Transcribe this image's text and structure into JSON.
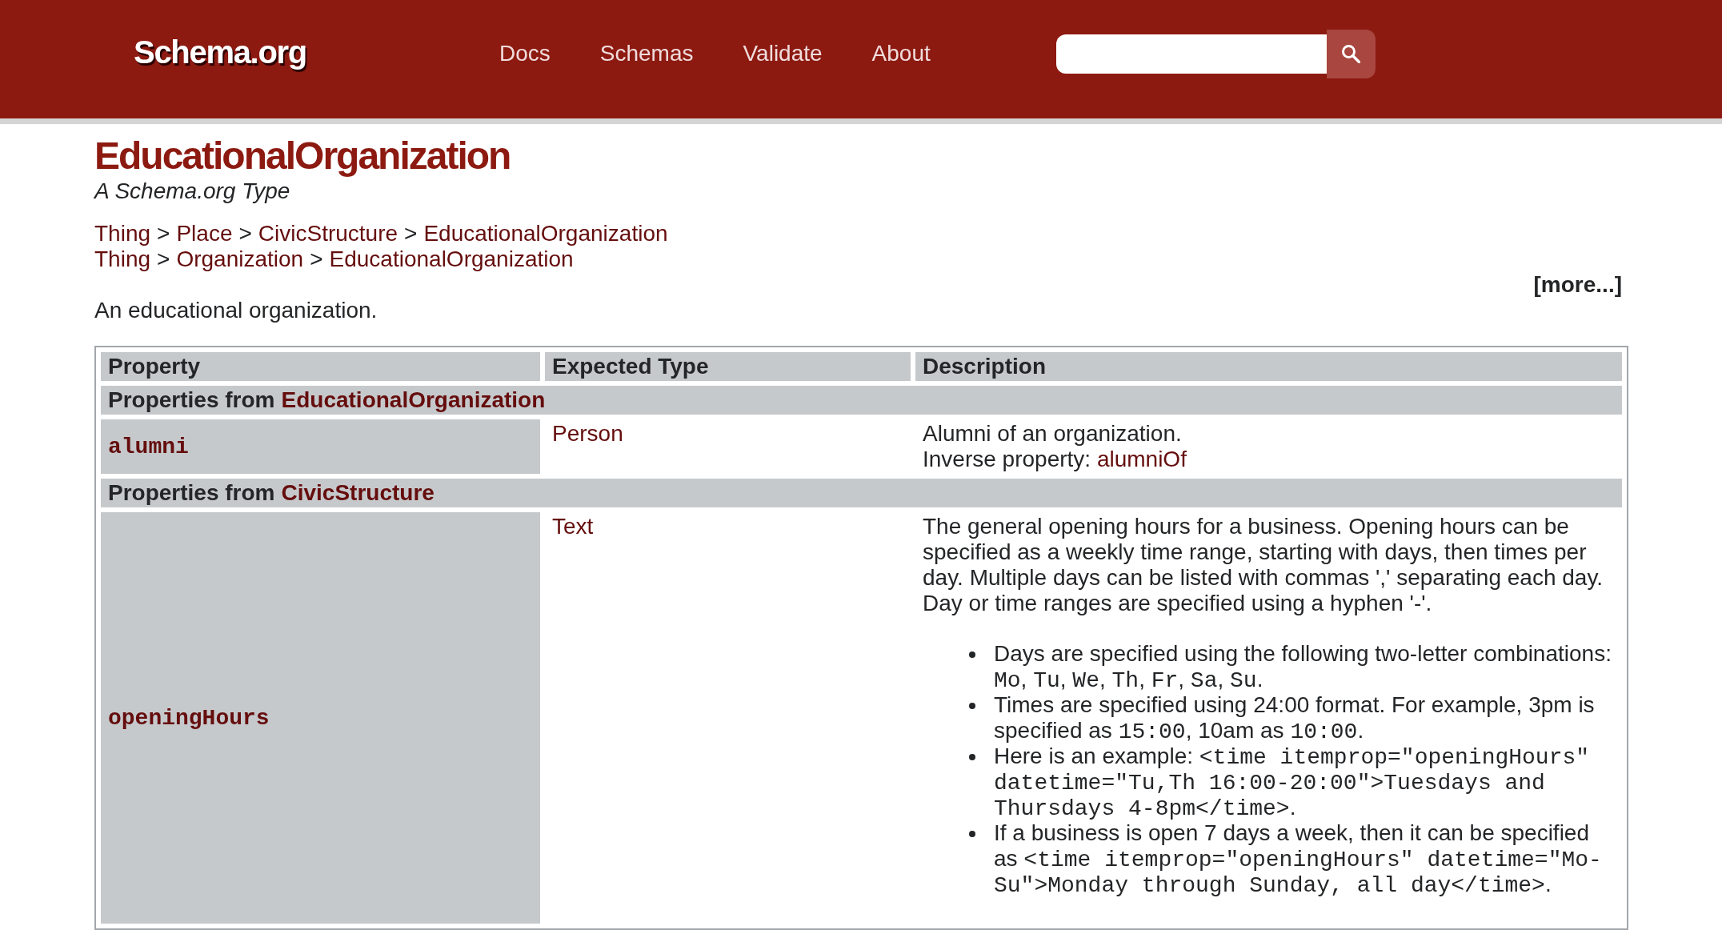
{
  "header": {
    "logo": "Schema.org",
    "nav": [
      "Docs",
      "Schemas",
      "Validate",
      "About"
    ]
  },
  "page": {
    "title": "EducationalOrganization",
    "subtitle": "A Schema.org Type",
    "breadcrumbs": [
      [
        {
          "kind": "link",
          "text": "Thing"
        },
        {
          "kind": "separator",
          "text": ">"
        },
        {
          "kind": "link",
          "text": "Place"
        },
        {
          "kind": "separator",
          "text": ">"
        },
        {
          "kind": "link",
          "text": "CivicStructure"
        },
        {
          "kind": "separator",
          "text": ">"
        },
        {
          "kind": "link",
          "text": "EducationalOrganization"
        }
      ],
      [
        {
          "kind": "link",
          "text": "Thing"
        },
        {
          "kind": "separator",
          "text": ">"
        },
        {
          "kind": "link",
          "text": "Organization"
        },
        {
          "kind": "separator",
          "text": ">"
        },
        {
          "kind": "link",
          "text": "EducationalOrganization"
        }
      ]
    ],
    "more_link": "[more...]",
    "description": "An educational organization."
  },
  "table": {
    "columns": [
      "Property",
      "Expected Type",
      "Description"
    ],
    "sections": [
      {
        "label": "Properties from",
        "type": "EducationalOrganization",
        "rows": [
          {
            "property": "alumni",
            "expected_type": "Person",
            "description": [
              {
                "kind": "line",
                "segments": [
                  {
                    "kind": "plain",
                    "text": "Alumni of an organization."
                  }
                ]
              },
              {
                "kind": "line",
                "segments": [
                  {
                    "kind": "plain",
                    "text": "Inverse property: "
                  },
                  {
                    "kind": "link",
                    "text": "alumniOf"
                  }
                ]
              }
            ]
          }
        ]
      },
      {
        "label": "Properties from",
        "type": "CivicStructure",
        "rows": [
          {
            "property": "openingHours",
            "expected_type": "Text",
            "description": [
              {
                "kind": "line",
                "segments": [
                  {
                    "kind": "plain",
                    "text": "The general opening hours for a business. Opening hours can be specified as a weekly time range, starting with days, then times per day. Multiple days can be listed with commas ',' separating each day. Day or time ranges are specified using a hyphen '-'."
                  }
                ]
              },
              {
                "kind": "list",
                "items": [
                  [
                    {
                      "kind": "plain",
                      "text": "Days are specified using the following two-letter combinations: "
                    },
                    {
                      "kind": "code",
                      "text": "Mo"
                    },
                    {
                      "kind": "plain",
                      "text": ", "
                    },
                    {
                      "kind": "code",
                      "text": "Tu"
                    },
                    {
                      "kind": "plain",
                      "text": ", "
                    },
                    {
                      "kind": "code",
                      "text": "We"
                    },
                    {
                      "kind": "plain",
                      "text": ", "
                    },
                    {
                      "kind": "code",
                      "text": "Th"
                    },
                    {
                      "kind": "plain",
                      "text": ", "
                    },
                    {
                      "kind": "code",
                      "text": "Fr"
                    },
                    {
                      "kind": "plain",
                      "text": ", "
                    },
                    {
                      "kind": "code",
                      "text": "Sa"
                    },
                    {
                      "kind": "plain",
                      "text": ", "
                    },
                    {
                      "kind": "code",
                      "text": "Su"
                    },
                    {
                      "kind": "plain",
                      "text": "."
                    }
                  ],
                  [
                    {
                      "kind": "plain",
                      "text": "Times are specified using 24:00 format. For example, 3pm is specified as "
                    },
                    {
                      "kind": "code",
                      "text": "15:00"
                    },
                    {
                      "kind": "plain",
                      "text": ", 10am as "
                    },
                    {
                      "kind": "code",
                      "text": "10:00"
                    },
                    {
                      "kind": "plain",
                      "text": "."
                    }
                  ],
                  [
                    {
                      "kind": "plain",
                      "text": "Here is an example: "
                    },
                    {
                      "kind": "code",
                      "text": "<time itemprop=\"openingHours\" datetime=\"Tu,Th 16:00-20:00\">Tuesdays and Thursdays 4-8pm</time>"
                    },
                    {
                      "kind": "plain",
                      "text": "."
                    }
                  ],
                  [
                    {
                      "kind": "plain",
                      "text": "If a business is open 7 days a week, then it can be specified as "
                    },
                    {
                      "kind": "code",
                      "text": "<time itemprop=\"openingHours\" datetime=\"Mo-Su\">Monday through Sunday, all day</time>"
                    },
                    {
                      "kind": "plain",
                      "text": "."
                    }
                  ]
                ]
              }
            ]
          }
        ]
      }
    ]
  }
}
